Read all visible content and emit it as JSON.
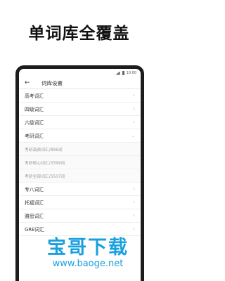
{
  "headline": "单词库全覆盖",
  "status_bar": {
    "time": "10:00"
  },
  "app_bar": {
    "title": "词库设置",
    "back_icon": "arrow-left-icon"
  },
  "list": {
    "items": [
      {
        "label": "高考词汇"
      },
      {
        "label": "四级词汇"
      },
      {
        "label": "六级词汇"
      },
      {
        "label": "考研词汇"
      },
      {
        "label": "专八词汇"
      },
      {
        "label": "托福词汇"
      },
      {
        "label": "雅思词汇"
      },
      {
        "label": "GRE词汇"
      }
    ],
    "kaoyan_sub": [
      {
        "label": "考研高频词汇/896词"
      },
      {
        "label": "考研核心词汇/3399词"
      },
      {
        "label": "考研全部词汇/5507词"
      }
    ]
  },
  "watermark": {
    "title": "宝哥下载",
    "url": "www.baoge.net",
    "color": "#19a0de"
  }
}
